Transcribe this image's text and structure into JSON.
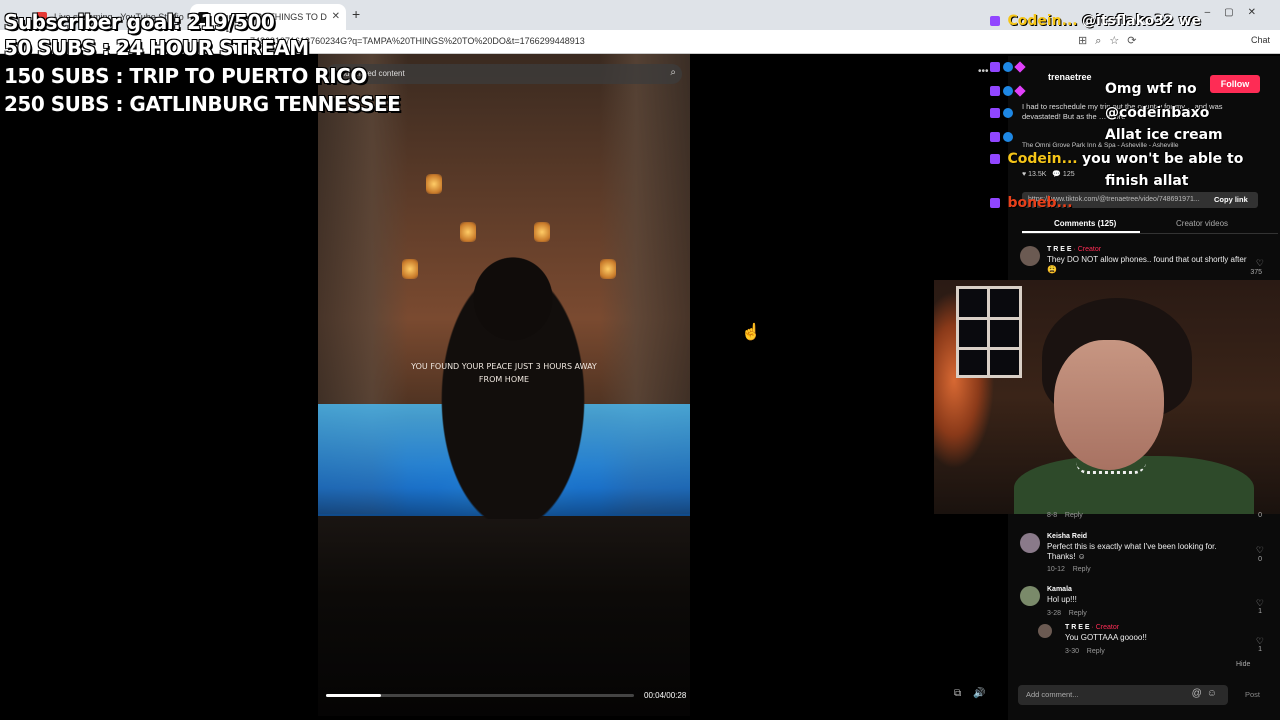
{
  "browser": {
    "tabs": [
      {
        "label": "Live streaming - YouTube Studio"
      },
      {
        "label": "Find 'TAMPA THINGS TO D"
      }
    ],
    "url": "748691971613760234G?q=TAMPA%20THINGS%20TO%20DO&t=1766299448913",
    "chat_button": "Chat"
  },
  "stream_overlay": {
    "goal_line": "Subscriber goal: 219/500",
    "milestones": [
      "50 SUBS : 24 HOUR STREAM",
      "150 SUBS : TRIP TO PUERTO RICO",
      "250 SUBS : GATLINBURG TENNESSEE"
    ]
  },
  "video": {
    "search_placeholder": "Find related content",
    "caption_line1": "YOU FOUND YOUR PEACE JUST 3 HOURS AWAY",
    "caption_line2": "FROM HOME",
    "time": "00:04/00:28",
    "progress": 0.18
  },
  "twitch_chat": [
    {
      "name": "Codein...",
      "message": "@itsflako32 we"
    },
    {
      "name": "",
      "message": "Omg wtf no"
    },
    {
      "name": "",
      "message": "@codeinbaxo"
    },
    {
      "name": "",
      "message": "Allat ice cream"
    },
    {
      "name": "Codein...",
      "message": "you won't be able to"
    },
    {
      "name": "",
      "message": "finish allat"
    },
    {
      "name": "boneb...",
      "message": ""
    }
  ],
  "post": {
    "author": "trenaetree",
    "follow_label": "Follow",
    "description": "I had to reschedule my trip out the country for my… and was devastated! But as the …  more",
    "location_line": "The Omni Grove Park Inn & Spa - Asheville - Asheville",
    "likes": "13.5K",
    "comments_count": "125",
    "link": "https://www.tiktok.com/@trenaetree/video/748691971...",
    "copy_link": "Copy link",
    "tab_comments": "Comments (125)",
    "tab_creator": "Creator videos"
  },
  "comments": [
    {
      "name": "T R E E",
      "creator": "· Creator",
      "text": "They DO NOT allow phones.. found that out shortly after 😩",
      "date": "",
      "reply": "",
      "likes": "375"
    },
    {
      "name": "",
      "creator": "",
      "text": "",
      "date": "8-8",
      "reply": "Reply",
      "likes": "0"
    },
    {
      "name": "Keisha Reid",
      "creator": "",
      "text": "Perfect this is exactly what I've been looking for. Thanks! ☺",
      "date": "10-12",
      "reply": "Reply",
      "likes": "0"
    },
    {
      "name": "Kamala",
      "creator": "",
      "text": "Hol up!!!",
      "date": "3-28",
      "reply": "Reply",
      "likes": "1"
    },
    {
      "name": "T R E E",
      "creator": "· Creator",
      "text": "You GOTTAAA goooo!!",
      "date": "3-30",
      "reply": "Reply",
      "likes": "1"
    }
  ],
  "hide_label": "Hide",
  "add_comment_placeholder": "Add comment...",
  "post_button": "Post",
  "colors": {
    "accent": "#fe2c55",
    "twitch": "#9146ff",
    "chat_name": "#f5c518"
  }
}
